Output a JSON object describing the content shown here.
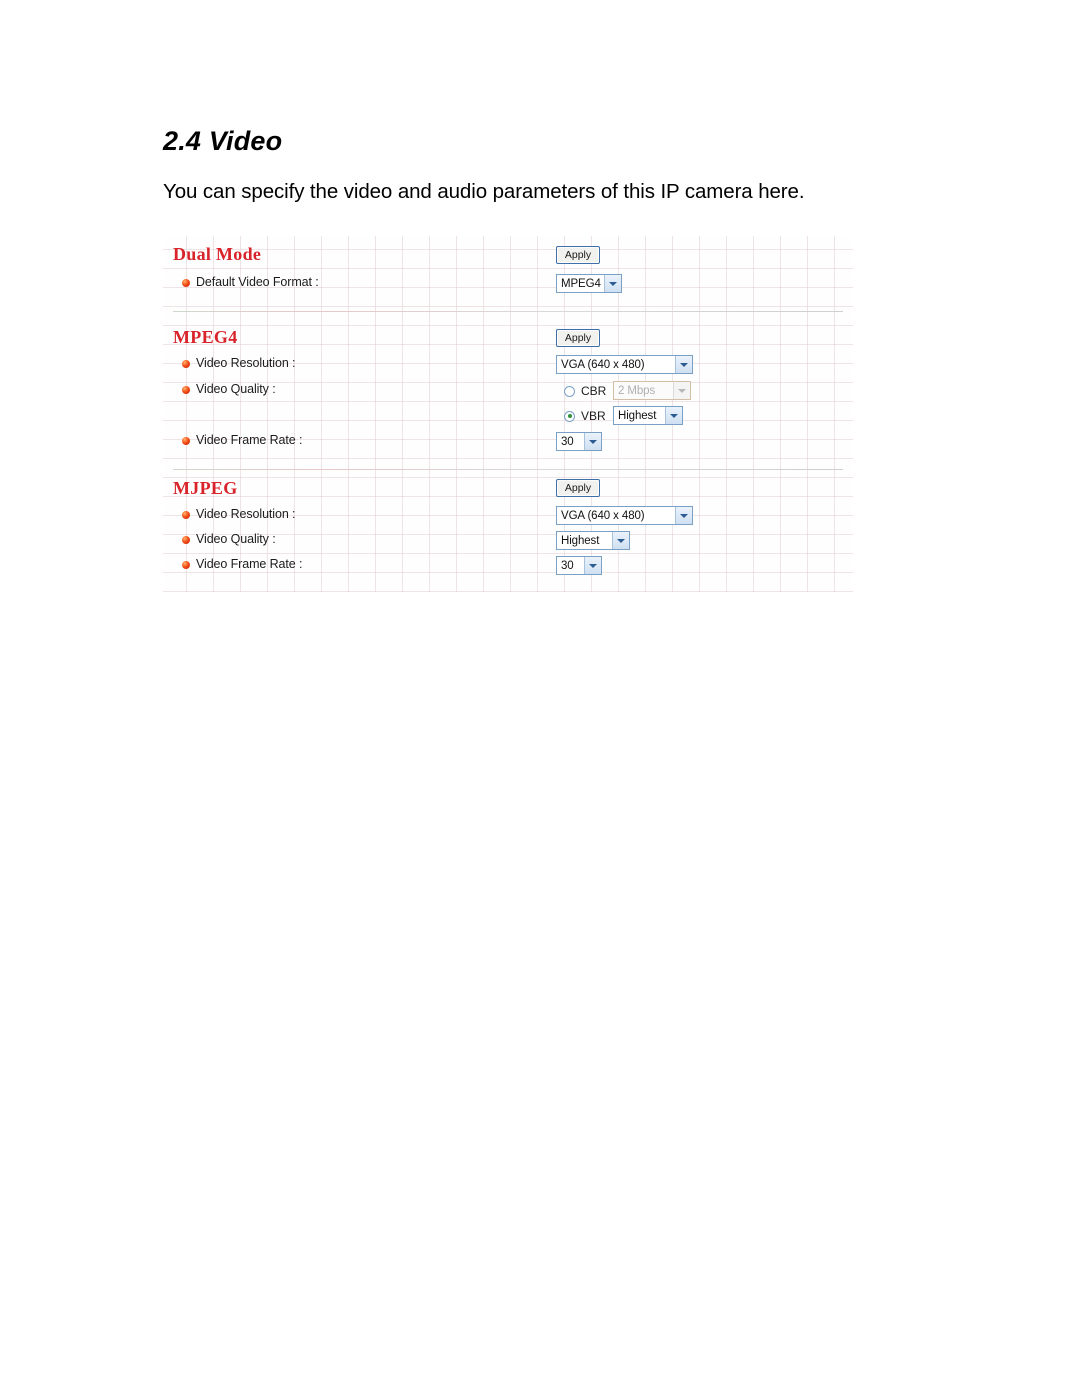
{
  "document": {
    "heading": "2.4 Video",
    "intro": "You can specify the video and audio parameters of this IP camera here."
  },
  "screenshot": {
    "sections": [
      {
        "title": "Dual Mode",
        "apply_label": "Apply",
        "fields": [
          {
            "label": "Default Video Format :",
            "value": "MPEG4"
          }
        ]
      },
      {
        "title": "MPEG4",
        "apply_label": "Apply",
        "fields": [
          {
            "label": "Video Resolution :",
            "value": "VGA (640 x 480)"
          },
          {
            "label": "Video Quality :",
            "value": ""
          },
          {
            "label": "Video Frame Rate :",
            "value": "30"
          }
        ],
        "quality": {
          "cbr_label": "CBR",
          "cbr_value": "2 Mbps",
          "cbr_selected": false,
          "vbr_label": "VBR",
          "vbr_value": "Highest",
          "vbr_selected": true
        }
      },
      {
        "title": "MJPEG",
        "apply_label": "Apply",
        "fields": [
          {
            "label": "Video Resolution :",
            "value": "VGA (640 x 480)"
          },
          {
            "label": "Video Quality :",
            "value": "Highest"
          },
          {
            "label": "Video Frame Rate :",
            "value": "30"
          }
        ]
      }
    ]
  }
}
